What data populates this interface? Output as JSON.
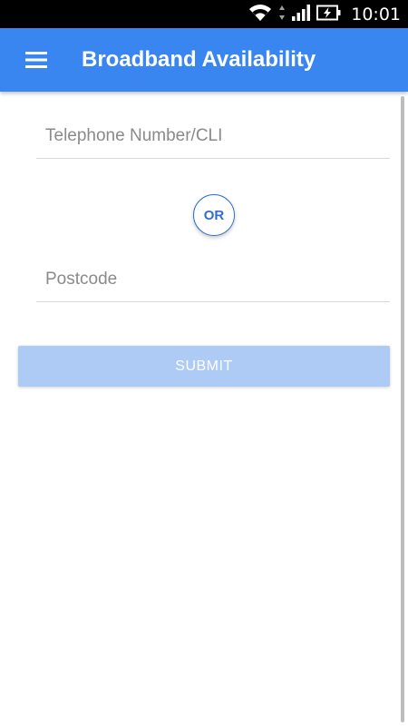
{
  "status_bar": {
    "time": "10:01",
    "icons": [
      "wifi-icon",
      "data-arrows-icon",
      "signal-icon",
      "battery-charging-icon"
    ]
  },
  "app_bar": {
    "title": "Broadband Availability",
    "menu_icon": "hamburger-menu-icon",
    "color": "#3a86f0"
  },
  "form": {
    "phone_placeholder": "Telephone Number/CLI",
    "phone_value": "",
    "separator_label": "OR",
    "postcode_placeholder": "Postcode",
    "postcode_value": "",
    "submit_label": "SUBMIT",
    "submit_color": "#aecbf5",
    "accent_color": "#2f6fd0"
  }
}
